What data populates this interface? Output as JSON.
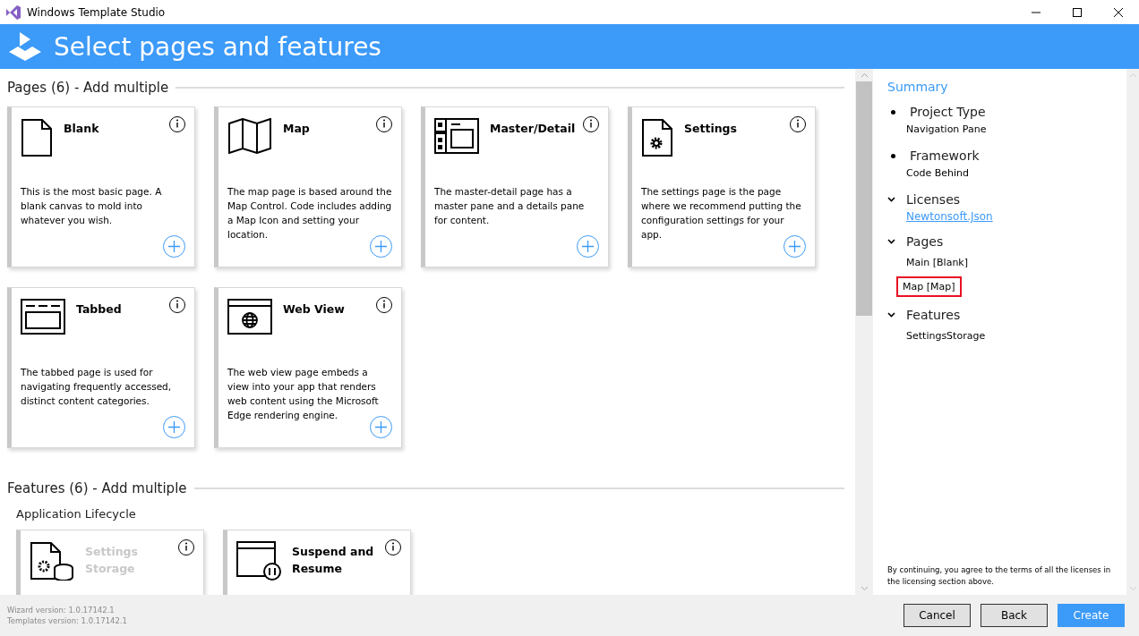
{
  "window": {
    "title": "Windows Template Studio"
  },
  "header": {
    "title": "Select pages and features"
  },
  "sections": [
    {
      "title": "Pages (6) - Add multiple",
      "groups": [
        {
          "cards": [
            {
              "title": "Blank",
              "description": "This is the most basic page. A blank canvas to mold into whatever you wish.",
              "disabled": false
            },
            {
              "title": "Map",
              "description": "The map page is based around the Map Control. Code includes adding a Map Icon and setting your location.",
              "disabled": false
            },
            {
              "title": "Master/Detail",
              "description": "The master-detail page has a master pane and a details pane for content.",
              "disabled": false
            },
            {
              "title": "Settings",
              "description": "The settings page is the page where we recommend putting the configuration settings for your app.",
              "disabled": false
            },
            {
              "title": "Tabbed",
              "description": "The tabbed page is used for navigating frequently accessed, distinct content categories.",
              "disabled": false
            },
            {
              "title": "Web View",
              "description": "The web view page embeds a view into your app that renders web content using the Microsoft Edge rendering engine.",
              "disabled": false
            }
          ]
        }
      ]
    },
    {
      "title": "Features (6) - Add multiple",
      "groups": [
        {
          "title": "Application Lifecycle",
          "cards": [
            {
              "title": "Settings Storage",
              "disabled": true
            },
            {
              "title": "Suspend and Resume",
              "disabled": false
            }
          ]
        }
      ]
    }
  ],
  "summary": {
    "title": "Summary",
    "items": [
      {
        "kind": "bullet",
        "label": "Project Type",
        "children": [
          {
            "text": "Navigation Pane"
          }
        ]
      },
      {
        "kind": "bullet",
        "label": "Framework",
        "children": [
          {
            "text": "Code Behind"
          }
        ]
      },
      {
        "kind": "expander",
        "label": "Licenses",
        "expanded": true,
        "children": [
          {
            "text": "Newtonsoft.Json",
            "link": true
          }
        ]
      },
      {
        "kind": "expander",
        "label": "Pages",
        "expanded": true,
        "children": [
          {
            "text": "Main [Blank]",
            "highlighted": false
          },
          {
            "text": "Map [Map]",
            "highlighted": true
          }
        ]
      },
      {
        "kind": "expander",
        "label": "Features",
        "expanded": true,
        "children": [
          {
            "text": "SettingsStorage"
          }
        ]
      }
    ],
    "notice": "By continuing, you agree to the terms of all the licenses in the licensing section above."
  },
  "footer": {
    "versions": [
      "Wizard version: 1.0.17142.1",
      "Templates version: 1.0.17142.1"
    ],
    "buttons": [
      {
        "label": "Cancel",
        "primary": false
      },
      {
        "label": "Back",
        "primary": false
      },
      {
        "label": "Create",
        "primary": true
      }
    ]
  }
}
